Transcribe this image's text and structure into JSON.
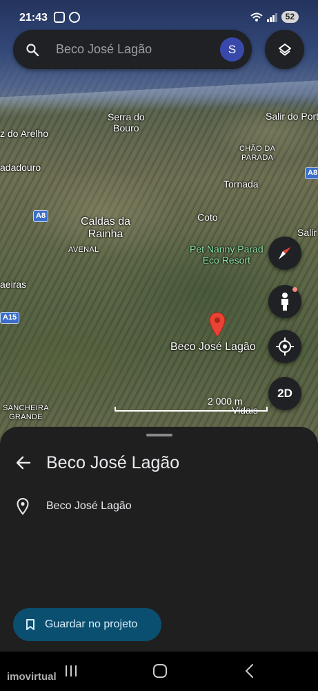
{
  "status_bar": {
    "time": "21:43",
    "battery": "52"
  },
  "search": {
    "text": "Beco José Lagão",
    "avatar_initial": "S"
  },
  "map": {
    "labels": {
      "serra_do_bouro": "Serra do\nBouro",
      "salir_do_porto": "Salir do Porto",
      "foz_do_arelho": "z do Arelho",
      "chao_da_parada": "CHÃO DA\nPARADA",
      "nadadouro": "adadouro",
      "tornada": "Tornada",
      "caldas_da_rainha": "Caldas da\nRainha",
      "coto": "Coto",
      "salir": "Salir",
      "avenal": "AVENAL",
      "pet_nanny": "Pet Nanny Parad\nEco Resort",
      "caeiras": "aeiras",
      "sancheira_grande": "SANCHEIRA\nGRANDE",
      "vidais": "Vidais",
      "pin_label": "Beco José Lagão"
    },
    "road_shields": {
      "a8_left": "A8",
      "a8_right": "A8",
      "a15": "A15"
    },
    "scale": "2 000 m",
    "controls": {
      "view_2d": "2D"
    }
  },
  "sheet": {
    "title": "Beco José Lagão",
    "address": "Beco José Lagão",
    "save_button": "Guardar no projeto"
  },
  "watermark": "imovirtual",
  "colors": {
    "accent_button": "#0b4f70",
    "pin": "#ea4335",
    "avatar": "#3949ab"
  }
}
